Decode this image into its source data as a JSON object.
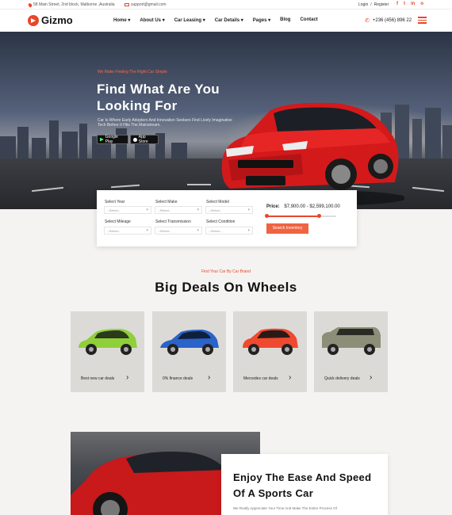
{
  "topbar": {
    "address": "58 Main Street, 2nd block, Malborne ,Australia",
    "email": "support@gmail.com",
    "login": "Login",
    "separator": "/",
    "register": "Register",
    "social": [
      "f",
      "t",
      "in",
      "o"
    ]
  },
  "nav": {
    "brand": "Gizmo",
    "items": [
      "Home ▾",
      "About Us ▾",
      "Car Leasing ▾",
      "Car Details ▾",
      "Pages ▾",
      "Blog",
      "Contact"
    ],
    "phone": "+236 (456) 896 22"
  },
  "hero": {
    "subtitle": "We Make Finding The Right Car Simple",
    "title": "Find What Are You Looking For",
    "description": "Car Is Where Early Adopters And Innovation Seekers Find Lively Imaginative Tech Before It Hits The Mainstream.",
    "google_play": "Google Play",
    "app_store": "App Store"
  },
  "search": {
    "fields": [
      {
        "label": "Select Year",
        "placeholder": "--Select--"
      },
      {
        "label": "Select Make",
        "placeholder": "--Select--"
      },
      {
        "label": "Select Model",
        "placeholder": "--Select--"
      },
      {
        "label": "Select Mileage",
        "placeholder": "--Select--"
      },
      {
        "label": "Select Transmission",
        "placeholder": "--Select--"
      },
      {
        "label": "Select Condition",
        "placeholder": "--Select--"
      }
    ],
    "price_label": "Price:",
    "price_range": "$7,900.00 - $2,599,100.00",
    "price_min_fraction": 0.0,
    "price_max_fraction": 0.75,
    "button": "Search Inventory"
  },
  "deals": {
    "subtitle": "Find Your Car By Car Brand",
    "title": "Big Deals On Wheels",
    "cards": [
      {
        "label": "Best new car deals",
        "color": "#8fcf3a"
      },
      {
        "label": "0% finance deals",
        "color": "#2a63c9"
      },
      {
        "label": "Mercedes  car deals",
        "color": "#ef4a2f"
      },
      {
        "label": "Quick delivery deals",
        "color": "#8c8e78"
      }
    ]
  },
  "feature": {
    "title": "Enjoy The Ease And Speed Of A Sports Car",
    "description": "We Really Appreciate Your Time And Make The Entire Process Of"
  },
  "colors": {
    "accent": "#e8472a"
  }
}
